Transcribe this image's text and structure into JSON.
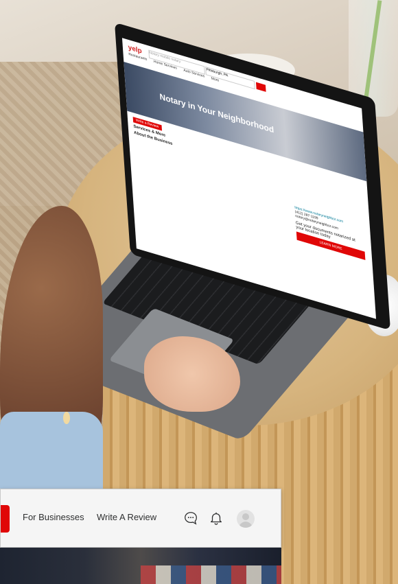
{
  "laptop_page": {
    "logo": "yelp",
    "search_placeholder": "Notary mobile notary",
    "location": "Pittsburgh, PA",
    "nav": [
      "Restaurants",
      "Home Services",
      "Auto Services",
      "More"
    ],
    "business_name": "Notary in Your Neighborhood",
    "write_review_btn": "Write a Review",
    "services_heading": "Services & More",
    "about_heading": "About the Business",
    "website": "https://www.notaryneighbor.com",
    "phone": "(412) 287-1199",
    "email": "notary@notaryneighbor.com",
    "cta_text": "Get your documents notarized at your location today",
    "cta_button": "LEARN MORE"
  },
  "zoom_header": {
    "for_businesses": "For Businesses",
    "write_review": "Write A Review",
    "icons": [
      "chat-icon",
      "bell-icon",
      "avatar"
    ],
    "accent_color": "#e00707"
  }
}
